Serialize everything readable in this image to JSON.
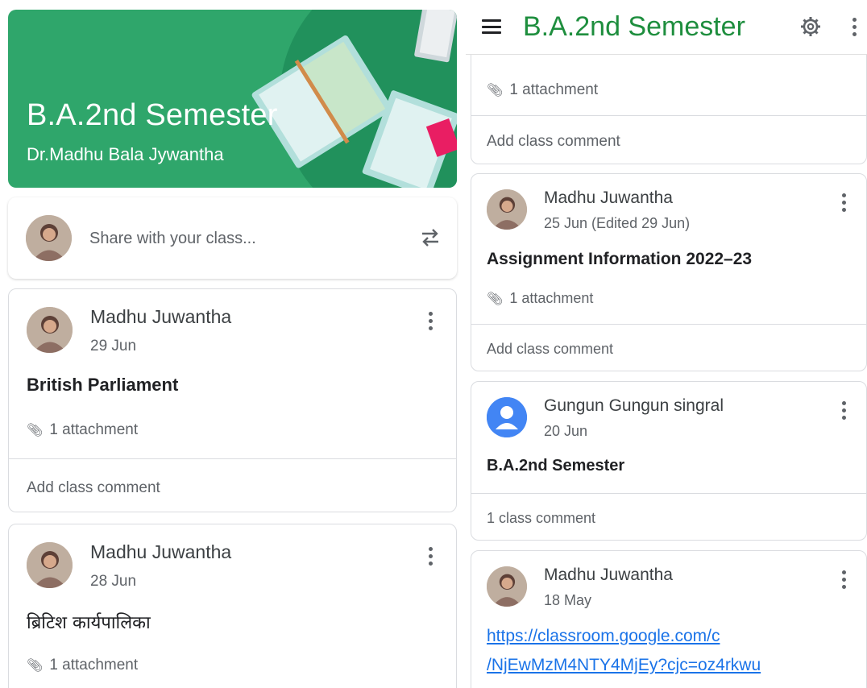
{
  "class": {
    "name": "B.A.2nd Semester",
    "teacher": "Dr.Madhu Bala Jywantha"
  },
  "share": {
    "placeholder": "Share with your class..."
  },
  "labels": {
    "add_comment": "Add class comment"
  },
  "posts_left": [
    {
      "author": "Madhu Juwantha",
      "date": "29 Jun",
      "title": "British Parliament",
      "attachments": "1 attachment",
      "comment": "Add class comment"
    },
    {
      "author": "Madhu Juwantha",
      "date": "28 Jun",
      "title": "ब्रिटिश कार्यपालिका",
      "attachments": "1 attachment"
    }
  ],
  "header": {
    "title": "B.A.2nd Semester"
  },
  "posts_right": [
    {
      "attachments": "1 attachment",
      "comment": "Add class comment"
    },
    {
      "author": "Madhu Juwantha",
      "date": "25 Jun (Edited 29 Jun)",
      "title": "Assignment Information 2022–23",
      "attachments": "1 attachment",
      "comment": "Add class comment"
    },
    {
      "author": "Gungun Gungun singral",
      "date": "20 Jun",
      "title": "B.A.2nd Semester",
      "comment": "1 class comment"
    },
    {
      "author": "Madhu Juwantha",
      "date": "18 May",
      "link_line1": "https://classroom.google.com/c",
      "link_line2": "/NjEwMzM4NTY4MjEy?cjc=oz4rkwu"
    }
  ],
  "colors": {
    "banner": "#2fa66b",
    "header_title": "#1e8e3e",
    "link": "#1a73e8"
  },
  "icons": [
    "menu-icon",
    "gear-icon",
    "more-vert-icon",
    "repost-icon",
    "attachment-icon",
    "default-user-icon"
  ]
}
